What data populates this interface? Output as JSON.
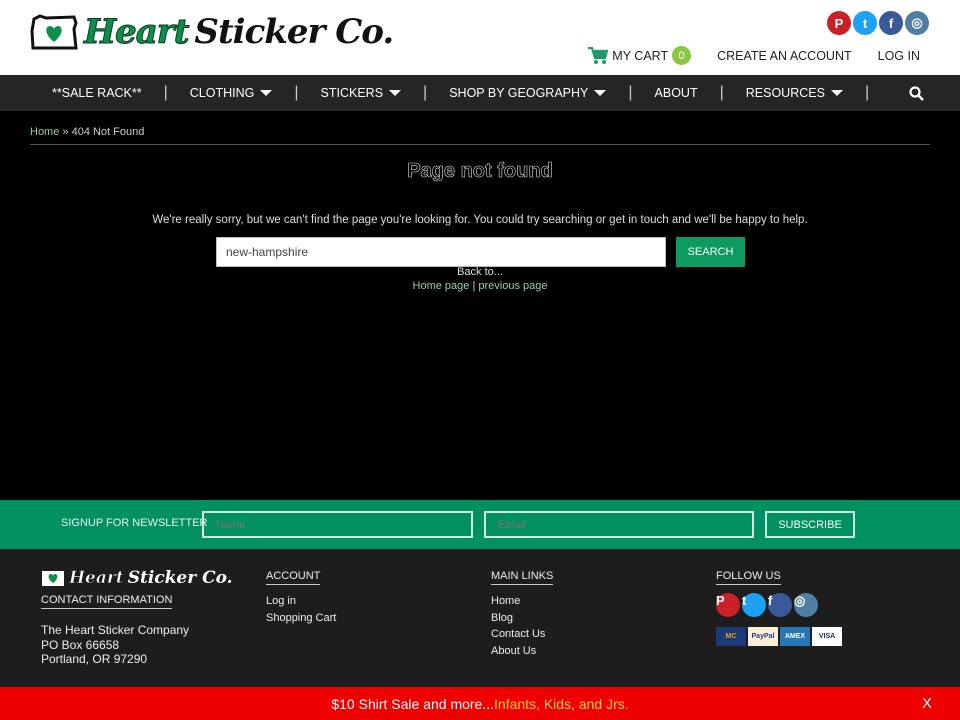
{
  "header": {
    "logo": {
      "word1": "Heart",
      "word2": "Sticker Co."
    },
    "social": [
      {
        "name": "pinterest",
        "glyph": "P",
        "color": "#cb2027"
      },
      {
        "name": "twitter",
        "glyph": "t",
        "color": "#1da1f2"
      },
      {
        "name": "facebook",
        "glyph": "f",
        "color": "#3b5998"
      },
      {
        "name": "instagram",
        "glyph": "◎",
        "color": "#517fa4"
      }
    ],
    "cart_label": "MY CART",
    "cart_count": "0",
    "create_account": "CREATE AN ACCOUNT",
    "login": "LOG IN"
  },
  "nav": {
    "items": [
      "**SALE RACK**",
      "CLOTHING",
      "STICKERS",
      "SHOP BY GEOGRAPHY",
      "ABOUT",
      "RESOURCES"
    ]
  },
  "breadcrumb": {
    "home": "Home",
    "sep": " » ",
    "current": "404 Not Found"
  },
  "main": {
    "title": "Page not found",
    "message": "We're really sorry, but we can't find the page you're looking for. You could try searching or get in touch and we'll be happy to help.",
    "search_value": "new-hampshire",
    "search_button": "SEARCH",
    "back_to": "Back to...",
    "home_link": "Home page",
    "divider": " | ",
    "previous_link": "previous page"
  },
  "newsletter": {
    "label": "SIGNUP FOR NEWSLETTER",
    "name_placeholder": "Name",
    "email_placeholder": "Email",
    "subscribe": "SUBSCRIBE"
  },
  "footer": {
    "logo": {
      "word1": "Heart",
      "word2": "Sticker Co."
    },
    "contact_heading": "CONTACT INFORMATION",
    "address": [
      "The Heart Sticker Company",
      "PO Box 66658",
      "Portland, OR 97290"
    ],
    "account_heading": "ACCOUNT",
    "account_links": [
      "Log in",
      "Shopping Cart"
    ],
    "main_heading": "MAIN LINKS",
    "main_links": [
      "Home",
      "Blog",
      "Contact Us",
      "About Us"
    ],
    "follow_heading": "FOLLOW US",
    "payments": [
      {
        "label": "MC",
        "bg": "#1a3a7a",
        "fg": "#f79e1b"
      },
      {
        "label": "PayPal",
        "bg": "#fdf0d5",
        "fg": "#253b80"
      },
      {
        "label": "AMEX",
        "bg": "#2478b8",
        "fg": "#fff"
      },
      {
        "label": "VISA",
        "bg": "#fff",
        "fg": "#1a1f71"
      }
    ]
  },
  "promo": {
    "text": "$10 Shirt Sale and more...",
    "highlight": "Infants, Kids, and Jrs.",
    "close": "X"
  },
  "colors": {
    "green": "#009061",
    "nav": "#252525",
    "promo": "#ee0000",
    "footer": "#1d1d1d"
  }
}
